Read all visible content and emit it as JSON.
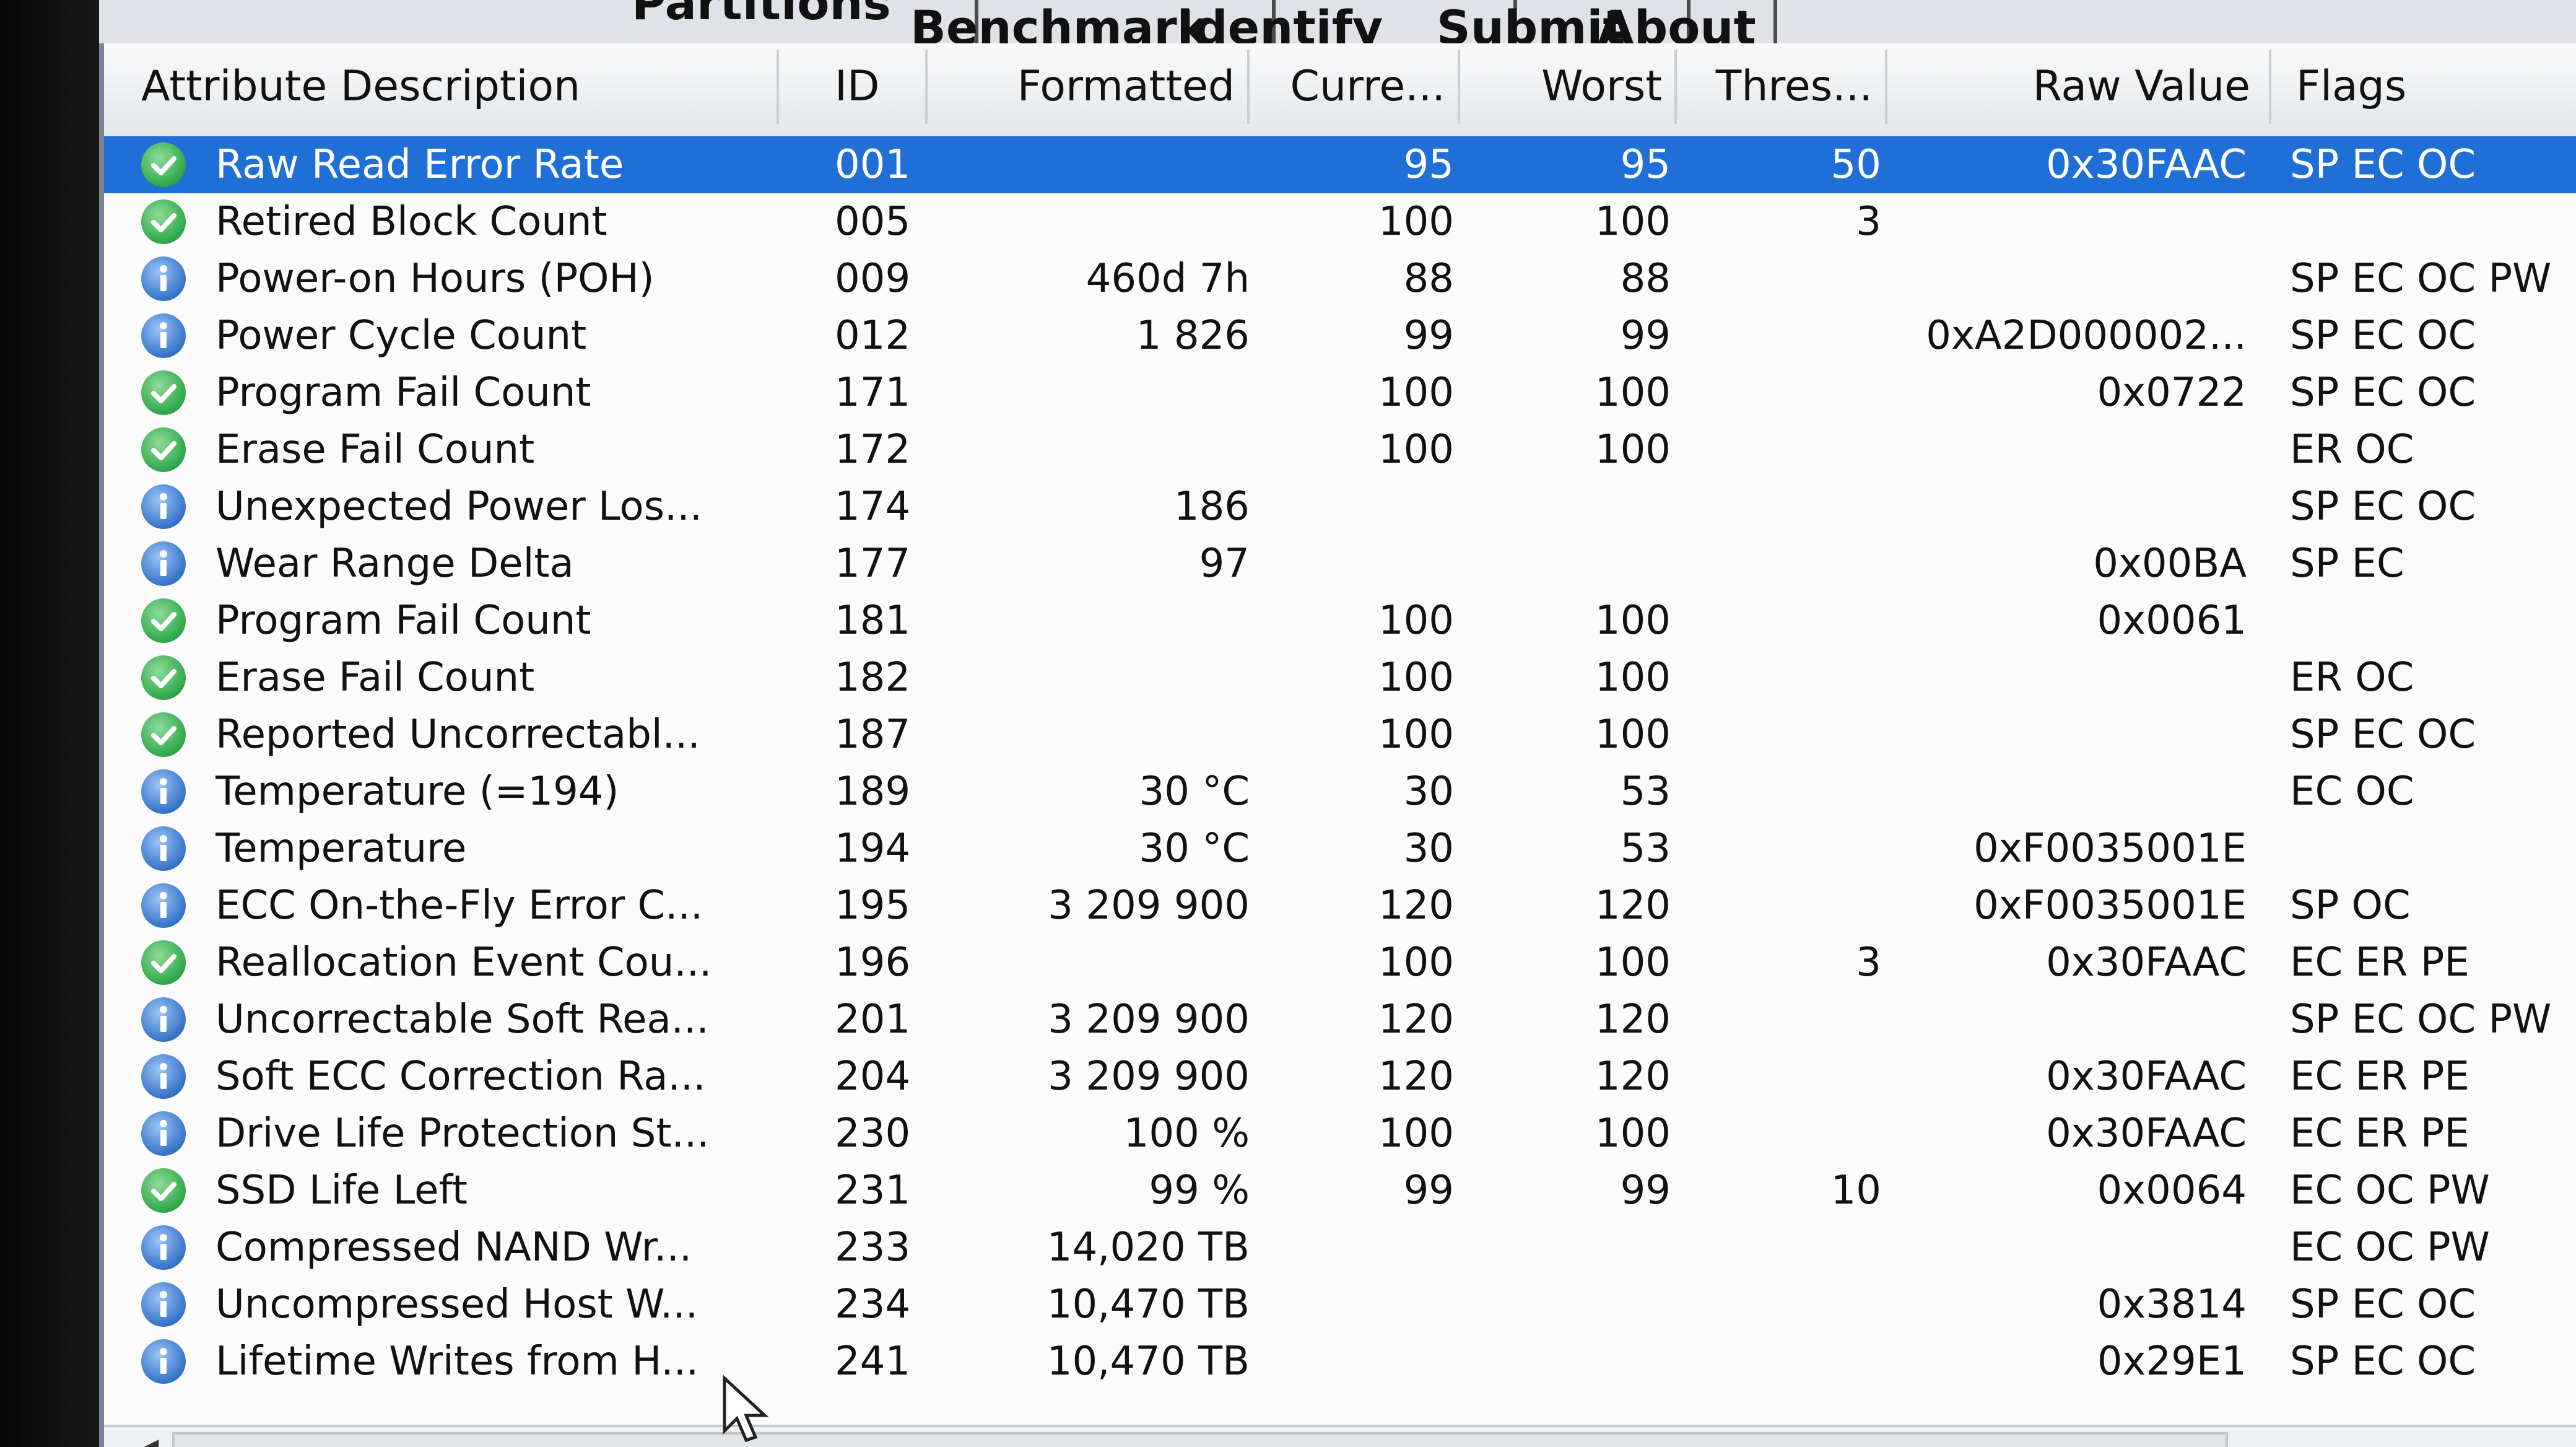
{
  "tabs": [
    "Partitions",
    "Benchmark",
    "Identify",
    "Submit",
    "About"
  ],
  "columns": [
    "Attribute Description",
    "ID",
    "Formatted",
    "Curre...",
    "Worst",
    "Thres...",
    "Raw Value",
    "Flags"
  ],
  "rows": [
    {
      "status": "ok",
      "desc": "Raw Read Error Rate",
      "id": "001",
      "formatted": "",
      "current": "95",
      "worst": "95",
      "threshold": "50",
      "raw": "0x30FAAC",
      "flags": "SP EC OC",
      "selected": true
    },
    {
      "status": "ok",
      "desc": "Retired Block Count",
      "id": "005",
      "formatted": "",
      "current": "100",
      "worst": "100",
      "threshold": "3",
      "raw": "",
      "flags": ""
    },
    {
      "status": "info",
      "desc": "Power-on Hours (POH)",
      "id": "009",
      "formatted": "460d 7h",
      "current": "88",
      "worst": "88",
      "threshold": "",
      "raw": "",
      "flags": "SP EC OC PW"
    },
    {
      "status": "info",
      "desc": "Power Cycle Count",
      "id": "012",
      "formatted": "1 826",
      "current": "99",
      "worst": "99",
      "threshold": "",
      "raw": "0xA2D000002...",
      "flags": "SP EC OC"
    },
    {
      "status": "ok",
      "desc": "Program Fail Count",
      "id": "171",
      "formatted": "",
      "current": "100",
      "worst": "100",
      "threshold": "",
      "raw": "0x0722",
      "flags": "SP EC OC"
    },
    {
      "status": "ok",
      "desc": "Erase Fail Count",
      "id": "172",
      "formatted": "",
      "current": "100",
      "worst": "100",
      "threshold": "",
      "raw": "",
      "flags": "ER OC"
    },
    {
      "status": "info",
      "desc": "Unexpected Power Los...",
      "id": "174",
      "formatted": "186",
      "current": "",
      "worst": "",
      "threshold": "",
      "raw": "",
      "flags": "SP EC OC"
    },
    {
      "status": "info",
      "desc": "Wear Range Delta",
      "id": "177",
      "formatted": "97",
      "current": "",
      "worst": "",
      "threshold": "",
      "raw": "0x00BA",
      "flags": "SP EC"
    },
    {
      "status": "ok",
      "desc": "Program Fail Count",
      "id": "181",
      "formatted": "",
      "current": "100",
      "worst": "100",
      "threshold": "",
      "raw": "0x0061",
      "flags": ""
    },
    {
      "status": "ok",
      "desc": "Erase Fail Count",
      "id": "182",
      "formatted": "",
      "current": "100",
      "worst": "100",
      "threshold": "",
      "raw": "",
      "flags": "ER OC"
    },
    {
      "status": "ok",
      "desc": "Reported Uncorrectabl...",
      "id": "187",
      "formatted": "",
      "current": "100",
      "worst": "100",
      "threshold": "",
      "raw": "",
      "flags": "SP EC OC"
    },
    {
      "status": "info",
      "desc": "Temperature (=194)",
      "id": "189",
      "formatted": "30 °C",
      "current": "30",
      "worst": "53",
      "threshold": "",
      "raw": "",
      "flags": "EC OC"
    },
    {
      "status": "info",
      "desc": "Temperature",
      "id": "194",
      "formatted": "30 °C",
      "current": "30",
      "worst": "53",
      "threshold": "",
      "raw": "0xF0035001E",
      "flags": ""
    },
    {
      "status": "info",
      "desc": "ECC On-the-Fly Error C...",
      "id": "195",
      "formatted": "3 209 900",
      "current": "120",
      "worst": "120",
      "threshold": "",
      "raw": "0xF0035001E",
      "flags": "SP OC"
    },
    {
      "status": "ok",
      "desc": "Reallocation Event Cou...",
      "id": "196",
      "formatted": "",
      "current": "100",
      "worst": "100",
      "threshold": "3",
      "raw": "0x30FAAC",
      "flags": "EC ER PE"
    },
    {
      "status": "info",
      "desc": "Uncorrectable Soft Rea...",
      "id": "201",
      "formatted": "3 209 900",
      "current": "120",
      "worst": "120",
      "threshold": "",
      "raw": "",
      "flags": "SP EC OC PW"
    },
    {
      "status": "info",
      "desc": "Soft ECC Correction Ra...",
      "id": "204",
      "formatted": "3 209 900",
      "current": "120",
      "worst": "120",
      "threshold": "",
      "raw": "0x30FAAC",
      "flags": "EC ER PE"
    },
    {
      "status": "info",
      "desc": "Drive Life Protection St...",
      "id": "230",
      "formatted": "100 %",
      "current": "100",
      "worst": "100",
      "threshold": "",
      "raw": "0x30FAAC",
      "flags": "EC ER PE"
    },
    {
      "status": "ok",
      "desc": "SSD Life Left",
      "id": "231",
      "formatted": "99 %",
      "current": "99",
      "worst": "99",
      "threshold": "10",
      "raw": "0x0064",
      "flags": "EC OC PW"
    },
    {
      "status": "info",
      "desc": "Compressed NAND Wr...",
      "id": "233",
      "formatted": "14,020 TB",
      "current": "",
      "worst": "",
      "threshold": "",
      "raw": "",
      "flags": "EC OC PW"
    },
    {
      "status": "info",
      "desc": "Uncompressed Host W...",
      "id": "234",
      "formatted": "10,470 TB",
      "current": "",
      "worst": "",
      "threshold": "",
      "raw": "0x3814",
      "flags": "SP EC OC"
    },
    {
      "status": "info",
      "desc": "Lifetime Writes from H...",
      "id": "241",
      "formatted": "10,470 TB",
      "current": "",
      "worst": "",
      "threshold": "",
      "raw": "0x29E1",
      "flags": "SP EC OC"
    }
  ],
  "colors": {
    "selected": "#1f6fd6",
    "ok": "#2fa84a",
    "info": "#3673c8"
  }
}
